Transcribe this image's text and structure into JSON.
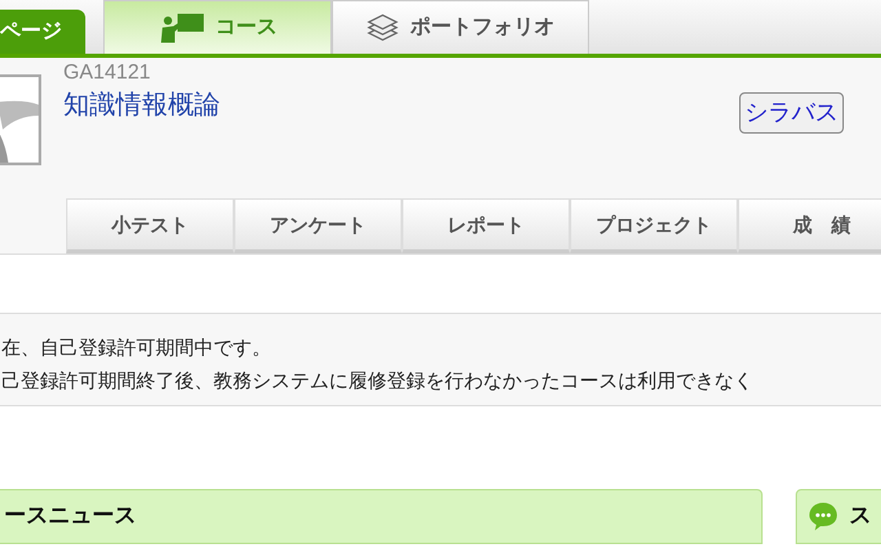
{
  "top_tabs": [
    {
      "label": "ページ",
      "kind": "home",
      "selected": false
    },
    {
      "label": "コース",
      "kind": "course",
      "selected": true
    },
    {
      "label": "ポートフォリオ",
      "kind": "portfolio",
      "selected": false
    }
  ],
  "course": {
    "code": "GA14121",
    "title": "知識情報概論",
    "syllabus_button": "シラバス"
  },
  "sub_tabs": [
    {
      "label": "小テスト"
    },
    {
      "label": "アンケート"
    },
    {
      "label": "レポート"
    },
    {
      "label": "プロジェクト"
    },
    {
      "label": "成　績"
    }
  ],
  "notice": [
    "在、自己登録許可期間中です。",
    "己登録許可期間終了後、教務システムに履修登録を行わなかったコースは利用できなく"
  ],
  "panels": [
    {
      "title": "ースニュース",
      "icon": false
    },
    {
      "title": "ス",
      "icon": true
    }
  ]
}
